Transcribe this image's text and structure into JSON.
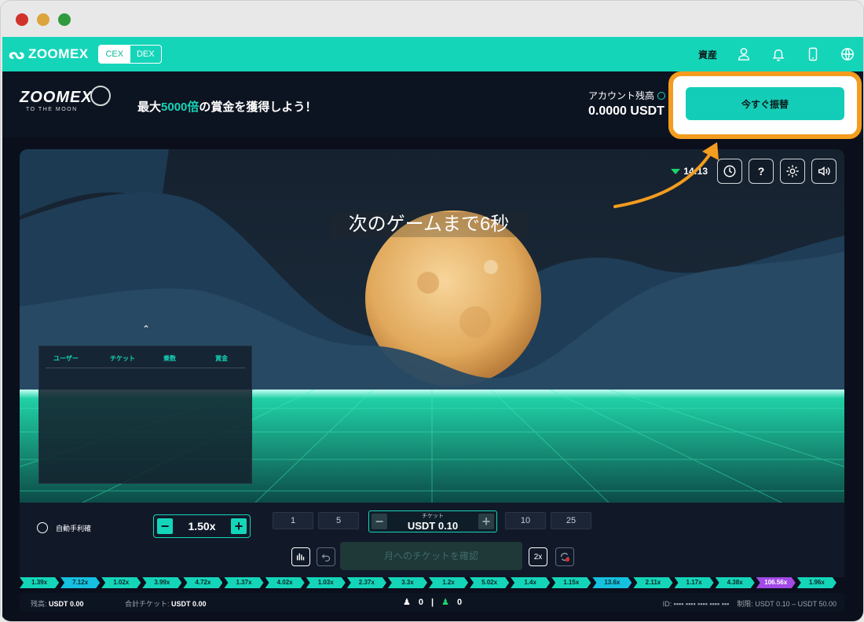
{
  "nav": {
    "brand": "ZOOMEX",
    "toggle_cex": "CEX",
    "toggle_dex": "DEX",
    "assets": "資産",
    "icons": [
      "user-icon",
      "bell-icon",
      "phone-icon",
      "globe-icon"
    ]
  },
  "header": {
    "logo_main": "ZOOMEX",
    "logo_sub": "TO THE MOON",
    "promo_prefix": "最大",
    "promo_highlight": "5000倍",
    "promo_suffix": "の賞金を獲得しよう！",
    "account_label": "アカウント残高",
    "account_value": "0.0000 USDT",
    "transfer_button": "今すぐ振替"
  },
  "game": {
    "countdown": "次のゲームまで6秒",
    "time": "14:13",
    "help": "?",
    "players_columns": [
      "ユーザー",
      "チケット",
      "乗数",
      "賞金"
    ]
  },
  "controls": {
    "auto_label": "自動手利確",
    "multiplier": "1.50x",
    "presets_left": [
      "1",
      "5"
    ],
    "ticket_label": "チケット",
    "ticket_value": "USDT 0.10",
    "presets_right": [
      "10",
      "25"
    ],
    "bet_label": "月へのチケットを確認",
    "double_label": "2x"
  },
  "history": [
    "1.39x",
    "7.12x",
    "1.02x",
    "3.99x",
    "4.72x",
    "1.37x",
    "4.02x",
    "1.03x",
    "2.37x",
    "3.3x",
    "1.2x",
    "5.02x",
    "1.4x",
    "1.15x",
    "13.6x",
    "2.11x",
    "1.17x",
    "4.38x",
    "106.56x",
    "1.96x"
  ],
  "status": {
    "balance_label": "残高:",
    "balance_value": "USDT 0.00",
    "tickets_label": "合計チケット:",
    "tickets_value": "USDT 0.00",
    "players_count": "0",
    "winners_count": "0",
    "id_label": "ID:",
    "limit": "制限: USDT 0.10 – USDT 50.00"
  },
  "colors": {
    "accent": "#15d5b9",
    "highlight": "#f39c1f",
    "purple": "#a24ae6",
    "blue": "#16c0e0"
  }
}
